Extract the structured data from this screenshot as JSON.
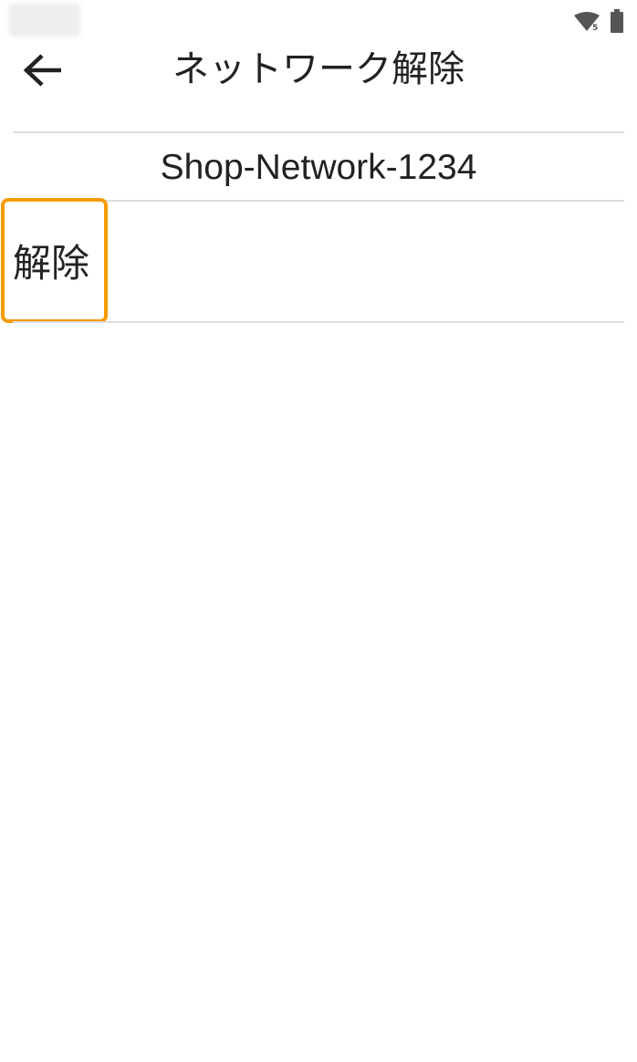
{
  "status_bar": {
    "wifi_icon": "wifi-signal-icon",
    "wifi_badge": "5",
    "battery_icon": "battery-full-icon"
  },
  "header": {
    "back_icon": "arrow-left-icon",
    "title": "ネットワーク解除"
  },
  "network": {
    "name": "Shop-Network-1234"
  },
  "actions": {
    "release_label": "解除"
  },
  "colors": {
    "highlight": "#f59a00",
    "divider": "#dddddd",
    "text": "#222222",
    "background": "#ffffff"
  }
}
